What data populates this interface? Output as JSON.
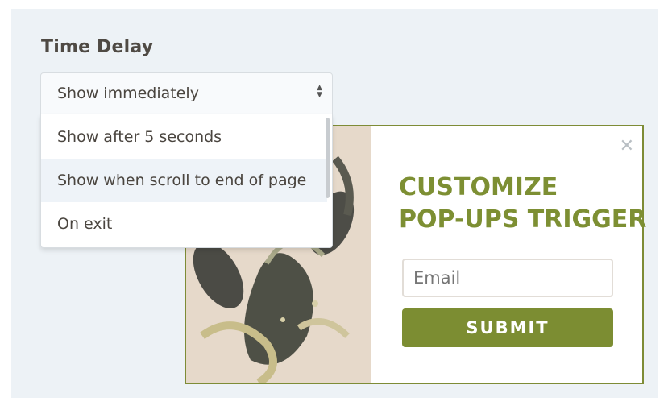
{
  "time_delay": {
    "label": "Time Delay",
    "selected": "Show immediately",
    "options": [
      "Show after 5 seconds",
      "Show when scroll to end of page",
      "On exit"
    ]
  },
  "popup": {
    "title_line1": "CUSTOMIZE",
    "title_line2": "POP-UPS TRIGGER",
    "email_placeholder": "Email",
    "submit_label": "SUBMIT",
    "close_icon": "close-icon",
    "accent_color": "#7c8d32"
  }
}
